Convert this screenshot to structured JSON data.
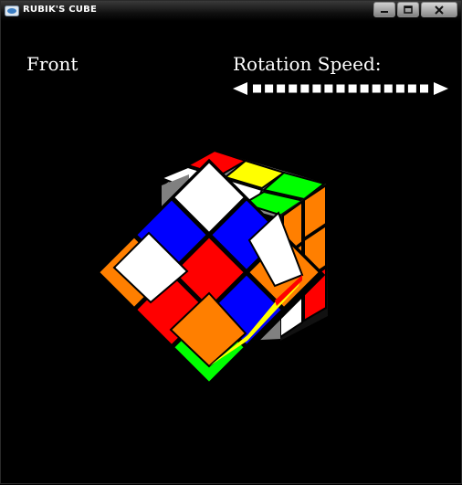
{
  "window": {
    "title": "RUBIK'S CUBE",
    "icon": "app-icon",
    "controls": [
      "minimize-icon",
      "maximize-icon",
      "close-icon"
    ]
  },
  "labels": {
    "face": "Front",
    "rotation_speed": "Rotation Speed:"
  },
  "slider": {
    "segments": 15,
    "value_fraction": 1.0
  },
  "colors": {
    "red": "#ff0000",
    "blue": "#0000ff",
    "green": "#00ff00",
    "white": "#ffffff",
    "orange": "#ff7f00",
    "yellow": "#ffff00",
    "gray": "#808080"
  }
}
